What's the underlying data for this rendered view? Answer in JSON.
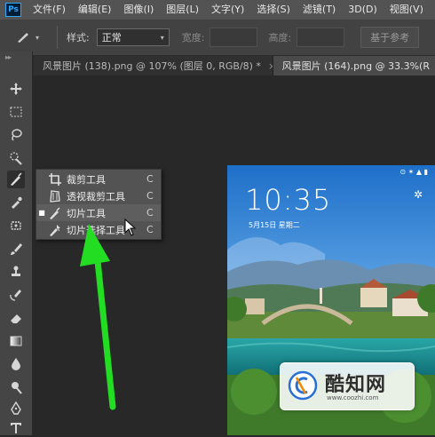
{
  "menubar": {
    "logo": "Ps",
    "items": [
      "文件(F)",
      "编辑(E)",
      "图像(I)",
      "图层(L)",
      "文字(Y)",
      "选择(S)",
      "滤镜(T)",
      "3D(D)",
      "视图(V)"
    ]
  },
  "options": {
    "tool_icon": "slice-tool-icon",
    "style_label": "样式:",
    "style_value": "正常",
    "width_label": "宽度:",
    "height_label": "高度:",
    "guides_button": "基于参考"
  },
  "tabs": [
    {
      "label": "风景图片 (138).png @ 107% (图层 0, RGB/8) *",
      "close": "×"
    },
    {
      "label": "风景图片 (164).png @ 33.3%(R",
      "close": ""
    }
  ],
  "flyout": {
    "items": [
      {
        "label": "裁剪工具",
        "key": "C",
        "selected": false,
        "icon": "crop-icon"
      },
      {
        "label": "透视裁剪工具",
        "key": "C",
        "selected": false,
        "icon": "perspective-crop-icon"
      },
      {
        "label": "切片工具",
        "key": "C",
        "selected": true,
        "icon": "slice-icon"
      },
      {
        "label": "切片选择工具",
        "key": "C",
        "selected": false,
        "icon": "slice-select-icon"
      }
    ]
  },
  "phone": {
    "time": "10:35",
    "date": "5月15日 星期二",
    "status": "⊙ ✶ ▲ ▮"
  },
  "watermark": {
    "name": "酷知网",
    "url": "www.coozhi.com"
  },
  "colors": {
    "arrow": "#22dd22",
    "menubar": "#535353",
    "toolbar": "#454545"
  }
}
